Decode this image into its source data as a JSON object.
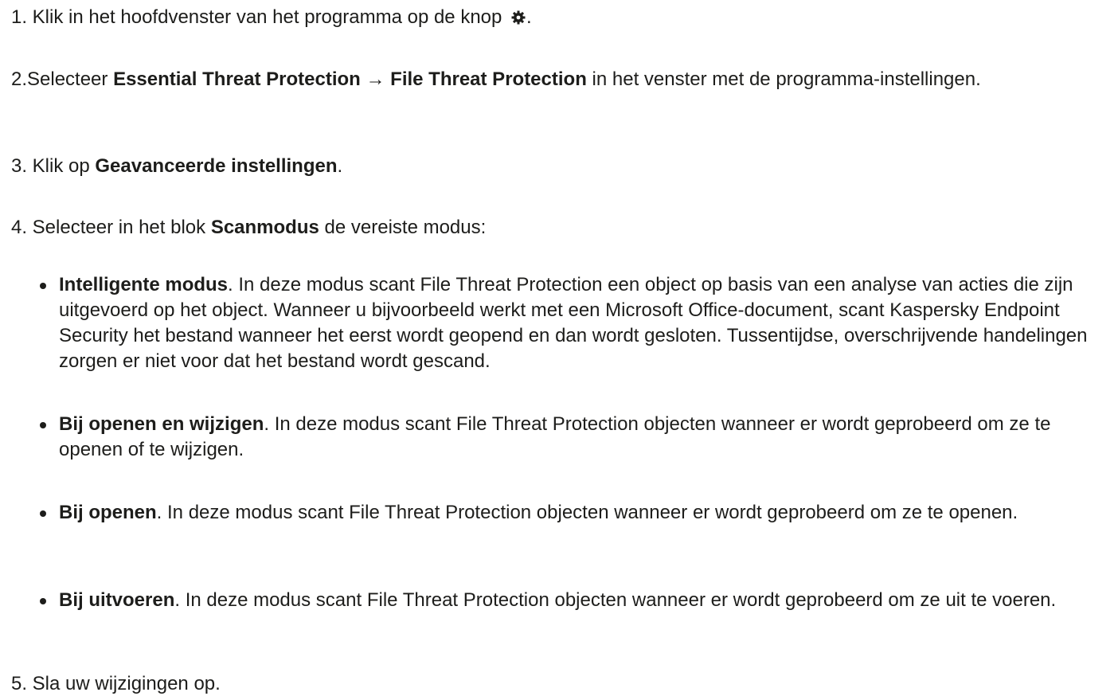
{
  "steps": [
    {
      "number": "1.",
      "text_before": "Klik in het hoofdvenster van het programma op de knop",
      "icon": "gear-icon",
      "text_after": "."
    },
    {
      "number": "2.",
      "text_before": "Selecteer ",
      "bold1": "Essential Threat Protection",
      "arrow": " → ",
      "bold2": "File Threat Protection",
      "text_after": " in het venster met de programma-instellingen."
    },
    {
      "number": "3.",
      "text_before": "Klik op ",
      "bold": "Geavanceerde instellingen",
      "text_after": "."
    },
    {
      "number": "4.",
      "text_before": "Selecteer in het blok ",
      "bold": "Scanmodus",
      "text_after": " de vereiste modus:"
    },
    {
      "number": "5.",
      "text": "Sla uw wijzigingen op."
    }
  ],
  "modes": [
    {
      "bold": "Intelligente modus",
      "text": ". In deze modus scant File Threat Protection een object op basis van een analyse van acties die zijn uitgevoerd op het object. Wanneer u bijvoorbeeld werkt met een Microsoft Office-document, scant Kaspersky Endpoint Security het bestand wanneer het eerst wordt geopend en dan wordt gesloten. Tussentijdse, overschrijvende handelingen zorgen er niet voor dat het bestand wordt gescand."
    },
    {
      "bold": "Bij openen en wijzigen",
      "text": ". In deze modus scant File Threat Protection objecten wanneer er wordt geprobeerd om ze te openen of te wijzigen."
    },
    {
      "bold": "Bij openen",
      "text": ". In deze modus scant File Threat Protection objecten wanneer er wordt geprobeerd om ze te openen."
    },
    {
      "bold": "Bij uitvoeren",
      "text": ". In deze modus scant File Threat Protection objecten wanneer er wordt geprobeerd om ze uit te voeren."
    }
  ]
}
